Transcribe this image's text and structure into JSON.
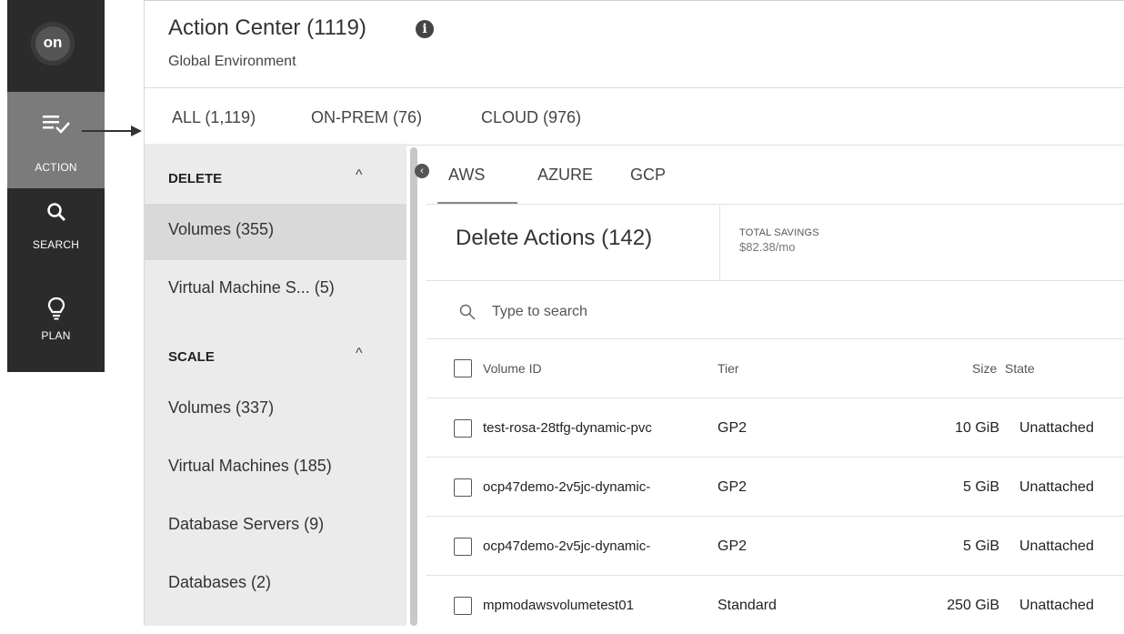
{
  "nav": {
    "logo_text": "on",
    "items": [
      {
        "label": "ACTION",
        "icon": "action-list-check-icon",
        "active": true
      },
      {
        "label": "SEARCH",
        "icon": "search-icon",
        "active": false
      },
      {
        "label": "PLAN",
        "icon": "lightbulb-icon",
        "active": false
      }
    ]
  },
  "header": {
    "title": "Action Center (1119)",
    "subtitle": "Global Environment"
  },
  "top_tabs": [
    {
      "label": "ALL (1,119)"
    },
    {
      "label": "ON-PREM (76)"
    },
    {
      "label": "CLOUD (976)"
    }
  ],
  "sidebar": {
    "sections": [
      {
        "title": "DELETE",
        "items": [
          {
            "label": "Volumes (355)",
            "active": true
          },
          {
            "label": "Virtual Machine S... (5)",
            "active": false
          }
        ]
      },
      {
        "title": "SCALE",
        "items": [
          {
            "label": "Volumes (337)",
            "active": false
          },
          {
            "label": "Virtual Machines (185)",
            "active": false
          },
          {
            "label": "Database Servers (9)",
            "active": false
          },
          {
            "label": "Databases (2)",
            "active": false
          }
        ]
      }
    ]
  },
  "cloud_tabs": [
    {
      "label": "AWS",
      "active": true
    },
    {
      "label": "AZURE",
      "active": false
    },
    {
      "label": "GCP",
      "active": false
    }
  ],
  "actions": {
    "title": "Delete Actions (142)",
    "savings_label": "TOTAL SAVINGS",
    "savings_value": "$82.38/mo"
  },
  "search": {
    "placeholder": "Type to search"
  },
  "table": {
    "columns": [
      "Volume ID",
      "Tier",
      "Size",
      "State"
    ],
    "rows": [
      {
        "id": "test-rosa-28tfg-dynamic-pvc",
        "tier": "GP2",
        "size": "10 GiB",
        "state": "Unattached"
      },
      {
        "id": "ocp47demo-2v5jc-dynamic-",
        "tier": "GP2",
        "size": "5 GiB",
        "state": "Unattached"
      },
      {
        "id": "ocp47demo-2v5jc-dynamic-",
        "tier": "GP2",
        "size": "5 GiB",
        "state": "Unattached"
      },
      {
        "id": "mpmodawsvolumetest01",
        "tier": "Standard",
        "size": "250 GiB",
        "state": "Unattached"
      }
    ]
  }
}
